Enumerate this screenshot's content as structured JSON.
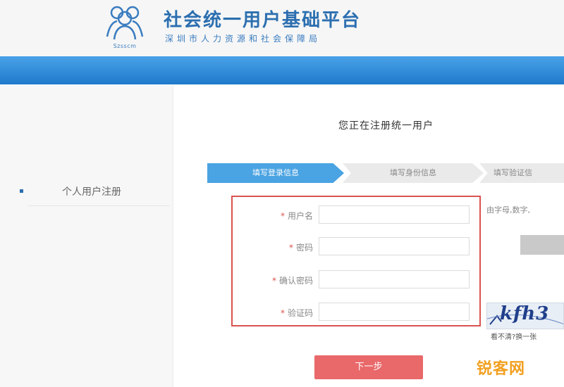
{
  "header": {
    "title": "社会统一用户基础平台",
    "subtitle": "深圳市人力资源和社会保障局",
    "logo_caption": "Szsscm",
    "brand_color": "#2c6fb0",
    "bar_color": "#2f86d3"
  },
  "sidebar": {
    "items": [
      {
        "label": "个人用户注册"
      }
    ]
  },
  "main": {
    "heading": "您正在注册统一用户",
    "steps": [
      {
        "label": "填写登录信息",
        "active": true
      },
      {
        "label": "填写身份信息",
        "active": false
      },
      {
        "label": "填写验证信",
        "active": false
      }
    ],
    "form": {
      "border_color": "#d9534f",
      "fields": [
        {
          "label": "用户名",
          "required": true,
          "value": ""
        },
        {
          "label": "密码",
          "required": true,
          "value": ""
        },
        {
          "label": "确认密码",
          "required": true,
          "value": ""
        },
        {
          "label": "验证码",
          "required": true,
          "value": ""
        }
      ]
    },
    "hint": "由字母,数字,",
    "captcha": {
      "text": "kfh3",
      "refresh_hint": "看不清?换一张"
    },
    "next_button": {
      "label": "下一步",
      "color": "#e9686a"
    }
  },
  "watermark": "锐客网"
}
